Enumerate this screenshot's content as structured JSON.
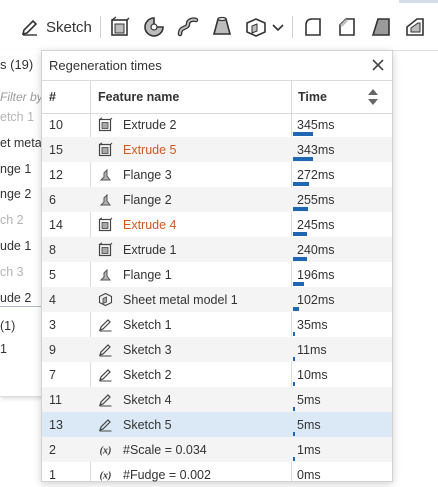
{
  "toolbar": {
    "sketch_label": "Sketch",
    "icons": [
      "sketch-pencil-icon",
      "extrude-icon",
      "revolve-icon",
      "sweep-icon",
      "loft-icon",
      "sheet-metal-icon",
      "fillet-icon",
      "chamfer-icon",
      "draft-icon",
      "shell-icon"
    ]
  },
  "left_panel": {
    "title": "s (19)",
    "filter_placeholder": "Filter by",
    "items": [
      {
        "label": "etch 1",
        "faded": true
      },
      {
        "label": "et meta",
        "faded": false
      },
      {
        "label": "nge 1",
        "faded": false
      },
      {
        "label": "nge 2",
        "faded": false
      },
      {
        "label": "ch 2",
        "faded": true
      },
      {
        "label": "ude 1",
        "faded": false
      },
      {
        "label": "ch 3",
        "faded": true
      },
      {
        "label": "ude 2",
        "faded": false
      },
      {
        "label": "(1)",
        "faded": false
      },
      {
        "label": "1",
        "faded": false
      }
    ]
  },
  "dialog": {
    "title": "Regeneration times",
    "columns": {
      "num": "#",
      "name": "Feature name",
      "time": "Time"
    },
    "rows": [
      {
        "num": "10",
        "icon": "extrude",
        "name": "Extrude 2",
        "time": "345ms",
        "ms": 345,
        "error": false
      },
      {
        "num": "15",
        "icon": "extrude",
        "name": "Extrude 5",
        "time": "343ms",
        "ms": 343,
        "error": true
      },
      {
        "num": "12",
        "icon": "flange",
        "name": "Flange 3",
        "time": "272ms",
        "ms": 272,
        "error": false
      },
      {
        "num": "6",
        "icon": "flange",
        "name": "Flange 2",
        "time": "255ms",
        "ms": 255,
        "error": false
      },
      {
        "num": "14",
        "icon": "extrude",
        "name": "Extrude 4",
        "time": "245ms",
        "ms": 245,
        "error": true
      },
      {
        "num": "8",
        "icon": "extrude",
        "name": "Extrude 1",
        "time": "240ms",
        "ms": 240,
        "error": false
      },
      {
        "num": "5",
        "icon": "flange",
        "name": "Flange 1",
        "time": "196ms",
        "ms": 196,
        "error": false
      },
      {
        "num": "4",
        "icon": "sheetmetal",
        "name": "Sheet metal model 1",
        "time": "102ms",
        "ms": 102,
        "error": false
      },
      {
        "num": "3",
        "icon": "sketch",
        "name": "Sketch 1",
        "time": "35ms",
        "ms": 35,
        "error": false
      },
      {
        "num": "9",
        "icon": "sketch",
        "name": "Sketch 3",
        "time": "11ms",
        "ms": 11,
        "error": false
      },
      {
        "num": "7",
        "icon": "sketch",
        "name": "Sketch 2",
        "time": "10ms",
        "ms": 10,
        "error": false
      },
      {
        "num": "11",
        "icon": "sketch",
        "name": "Sketch 4",
        "time": "5ms",
        "ms": 5,
        "error": false
      },
      {
        "num": "13",
        "icon": "sketch",
        "name": "Sketch 5",
        "time": "5ms",
        "ms": 5,
        "error": false,
        "selected": true
      },
      {
        "num": "2",
        "icon": "variable",
        "name": "#Scale = 0.034",
        "time": "1ms",
        "ms": 1,
        "error": false
      },
      {
        "num": "1",
        "icon": "variable",
        "name": "#Fudge = 0.002",
        "time": "0ms",
        "ms": 0,
        "error": false
      }
    ]
  },
  "colors": {
    "accent": "#1f66b3",
    "error_text": "#d2581f",
    "selected_row": "#dbe9f6",
    "alt_row": "#f4f4f4"
  }
}
